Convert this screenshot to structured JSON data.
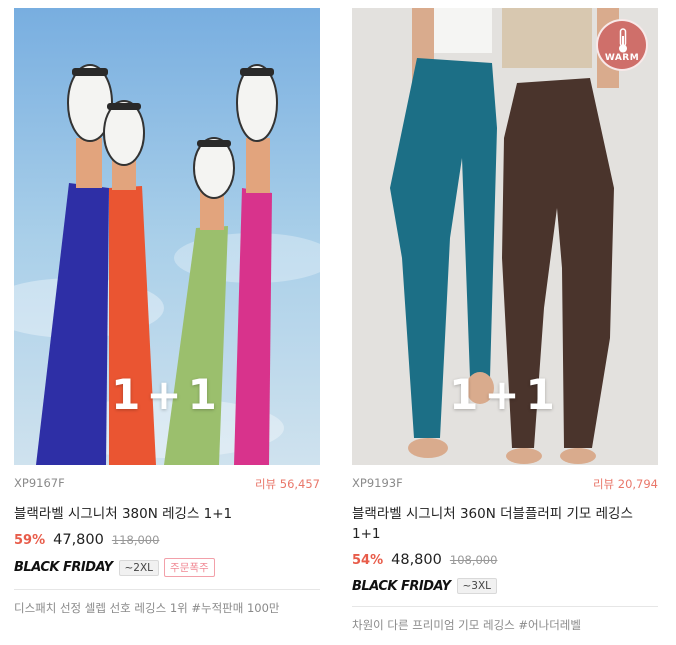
{
  "products": [
    {
      "overlay": "1+1",
      "code": "XP9167F",
      "reviews": "리뷰 56,457",
      "title": "블랙라벨 시그니처 380N 레깅스 1+1",
      "discount": "59%",
      "price": "47,800",
      "original_price": "118,000",
      "event_label": "BLACK FRIDAY",
      "size_tag": "~2XL",
      "hot_tag": "주문폭주",
      "description": "디스패치 선정 셀렙 선호 레깅스 1위 #누적판매 100만",
      "colors": {
        "sky": "#9fc6e4",
        "leg1": "#2e2fa6",
        "leg2": "#ea5532",
        "leg3": "#9bbf6d",
        "leg4": "#d8338c"
      }
    },
    {
      "overlay": "1+1",
      "badge": "WARM",
      "code": "XP9193F",
      "reviews": "리뷰 20,794",
      "title": "블랙라벨 시그니처 360N 더블플러피 기모 레깅스 1+1",
      "discount": "54%",
      "price": "48,800",
      "original_price": "108,000",
      "event_label": "BLACK FRIDAY",
      "size_tag": "~3XL",
      "description": "차원이 다른 프리미엄 기모 레깅스 #어나더레벨",
      "colors": {
        "bg": "#e3e1de",
        "teal": "#1c6f86",
        "brown": "#4a342c",
        "badge": "#cf6f6a"
      }
    }
  ]
}
